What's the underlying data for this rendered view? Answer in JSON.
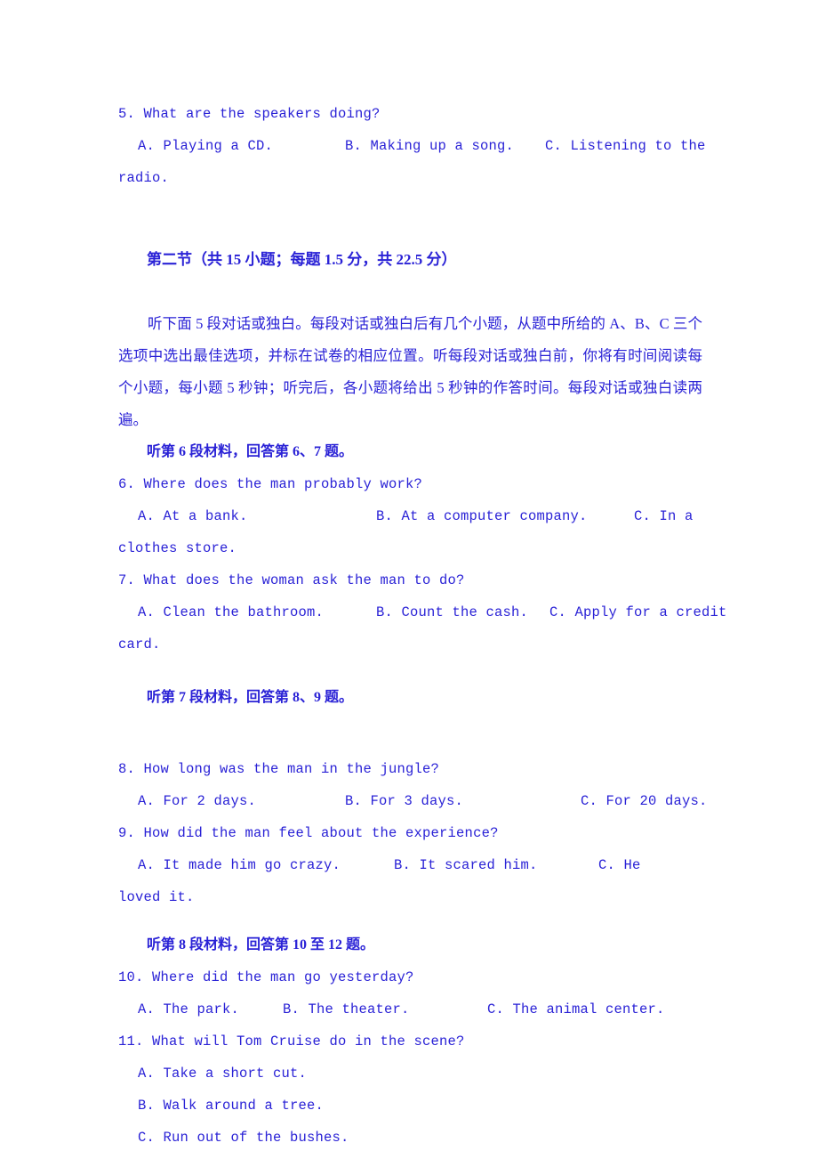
{
  "document": {
    "type": "english-listening-exam-paper",
    "text_color": "#2a22d6",
    "background_color": "#ffffff"
  },
  "q5": {
    "stem": "5. What are the speakers doing?",
    "a": "A. Playing a CD.",
    "b": "B. Making up a song.",
    "c": "C.  Listening  to  the",
    "c_cont": "radio."
  },
  "section2": {
    "heading": "第二节（共 15 小题；每题 1.5 分，共 22.5 分）",
    "instructions": "听下面 5 段对话或独白。每段对话或独白后有几个小题，从题中所给的 A、B、C 三个选项中选出最佳选项，并标在试卷的相应位置。听每段对话或独白前，你将有时间阅读每个小题，每小题 5 秒钟；听完后，各小题将给出 5 秒钟的作答时间。每段对话或独白读两遍。"
  },
  "material6": {
    "heading": "听第 6 段材料，回答第 6、7 题。"
  },
  "q6": {
    "stem": "6. Where does the man probably work?",
    "a": "A. At a bank.",
    "b": "B. At a computer company.",
    "c": "C.  In  a",
    "c_cont": "clothes store."
  },
  "q7": {
    "stem": "7. What does the woman ask the man to do?",
    "a": "A. Clean the bathroom.",
    "b": "B. Count the cash.",
    "c": "C. Apply for a credit",
    "c_cont": "card."
  },
  "material7": {
    "heading": "听第 7 段材料，回答第 8、9 题。"
  },
  "q8": {
    "stem": "8. How long was the man in the jungle?",
    "a": "A. For 2 days.",
    "b": "B. For 3 days.",
    "c": "C. For 20 days."
  },
  "q9": {
    "stem": "9. How did the man feel about the experience?",
    "a": "A. It made him go crazy.",
    "b": "B. It scared him.",
    "c": "C.    He",
    "c_cont": "loved it."
  },
  "material8": {
    "heading": "听第 8 段材料，回答第 10 至 12 题。"
  },
  "q10": {
    "stem": "10. Where did the man go yesterday?",
    "a": "A. The park.",
    "b": "B. The theater.",
    "c": "C. The animal center."
  },
  "q11": {
    "stem": "11. What will Tom Cruise do in the scene?",
    "a": "A. Take a short cut.",
    "b": "B. Walk around a tree.",
    "c": "C. Run out of the bushes."
  }
}
